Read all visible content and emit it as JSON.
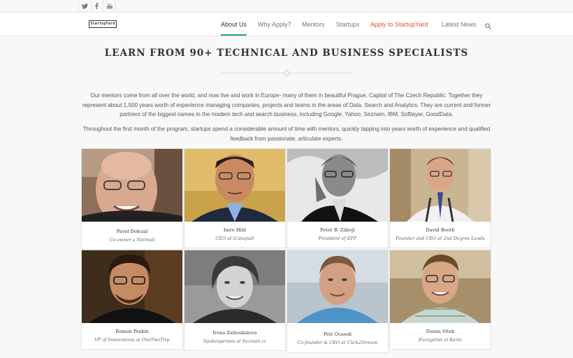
{
  "topbar": {
    "social": [
      {
        "icon": "twitter-icon",
        "glyph": "🐦"
      },
      {
        "icon": "facebook-icon",
        "glyph": "f"
      },
      {
        "icon": "youtube-icon",
        "glyph": "▶"
      }
    ]
  },
  "header": {
    "logo_text": "StartupYard",
    "nav": [
      {
        "label": "About Us",
        "active": true
      },
      {
        "label": "Why Apply?"
      },
      {
        "label": "Mentors"
      },
      {
        "label": "Startups"
      },
      {
        "label": "Apply to StartupYard",
        "accent": true
      },
      {
        "label": "Latest News"
      }
    ]
  },
  "colors": {
    "accent_green": "#2aa36b",
    "accent_orange": "#e6522c"
  },
  "section": {
    "title": "LEARN FROM 90+ TECHNICAL AND BUSINESS SPECIALISTS",
    "paragraph1": "Our mentors come from all over the world, and now live and work in Europe- many of them in beautiful Prague, Capital of The Czech Republic. Together they represent about 1,500 years worth of experience managing companies, projects and teams in the areas of Data, Search and Analytics. They are current and former partners of the biggest names in the modern tech and search business, including Google, Yahoo, Seznam, IBM, Softlayer, GoodData.",
    "paragraph2": "Throughout the first month of the program, startups spend a considerable amount of time with mentors, quickly tapping into years worth of experience and qualified feedback from passionate, articulate experts."
  },
  "mentors": [
    {
      "name": "Pavel Dolezal",
      "role": "Co-owner a Netmail"
    },
    {
      "name": "Imre Hild",
      "role": "CEO at iCatapult"
    },
    {
      "name": "Peter B. Záboji",
      "role": "President of EFF"
    },
    {
      "name": "David Booth",
      "role": "Founder and CEO at 2nd Degree Leads"
    },
    {
      "name": "Roman Peskin",
      "role": "VP of Innovations at OneTwoTrip"
    },
    {
      "name": "Irena Zatloukalova",
      "role": "Spokesperson at Seznam.cz"
    },
    {
      "name": "Petr Ocasek",
      "role": "Co-founder & CEO at Click2Stream"
    },
    {
      "name": "Dusan Vitek",
      "role": "Evangelist at Kerio"
    }
  ]
}
